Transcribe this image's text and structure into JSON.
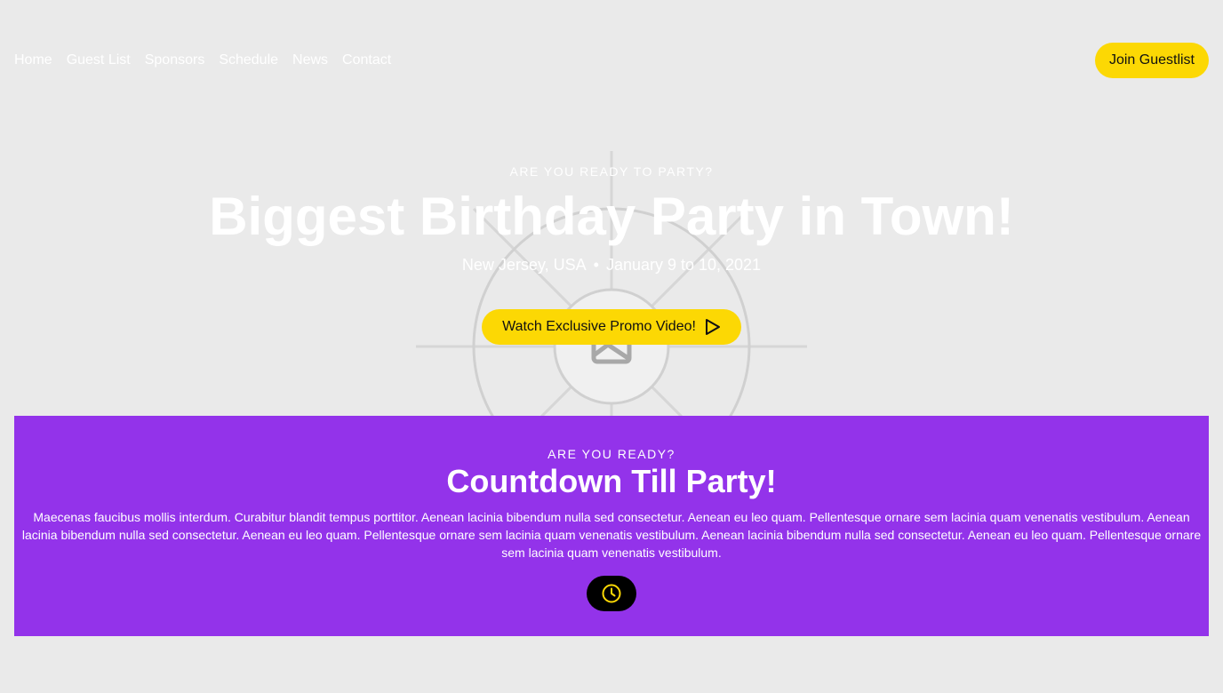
{
  "nav": {
    "items": [
      "Home",
      "Guest List",
      "Sponsors",
      "Schedule",
      "News",
      "Contact"
    ],
    "cta_label": "Join Guestlist"
  },
  "hero": {
    "eyebrow": "ARE YOU READY TO PARTY?",
    "title": "Biggest Birthday Party in Town!",
    "location": "New Jersey, USA",
    "separator": "•",
    "dates": "January 9 to 10, 2021",
    "promo_label": "Watch Exclusive Promo Video!",
    "promo_icon": "play-icon",
    "background_icon": "image-placeholder-icon"
  },
  "countdown": {
    "eyebrow": "ARE YOU READY?",
    "title": "Countdown Till Party!",
    "body": "Maecenas faucibus mollis interdum. Curabitur blandit tempus porttitor. Aenean lacinia bibendum nulla sed consectetur. Aenean eu leo quam. Pellentesque ornare sem lacinia quam venenatis vestibulum. Aenean lacinia bibendum nulla sed consectetur. Aenean eu leo quam. Pellentesque ornare sem lacinia quam venenatis vestibulum. Aenean lacinia bibendum nulla sed consectetur. Aenean eu leo quam. Pellentesque ornare sem lacinia quam venenatis vestibulum.",
    "button_icon": "clock-icon"
  },
  "colors": {
    "background": "#eaeaea",
    "accent_yellow": "#fcd804",
    "countdown_purple": "#9333ea",
    "text_on_dark": "#ffffff"
  }
}
